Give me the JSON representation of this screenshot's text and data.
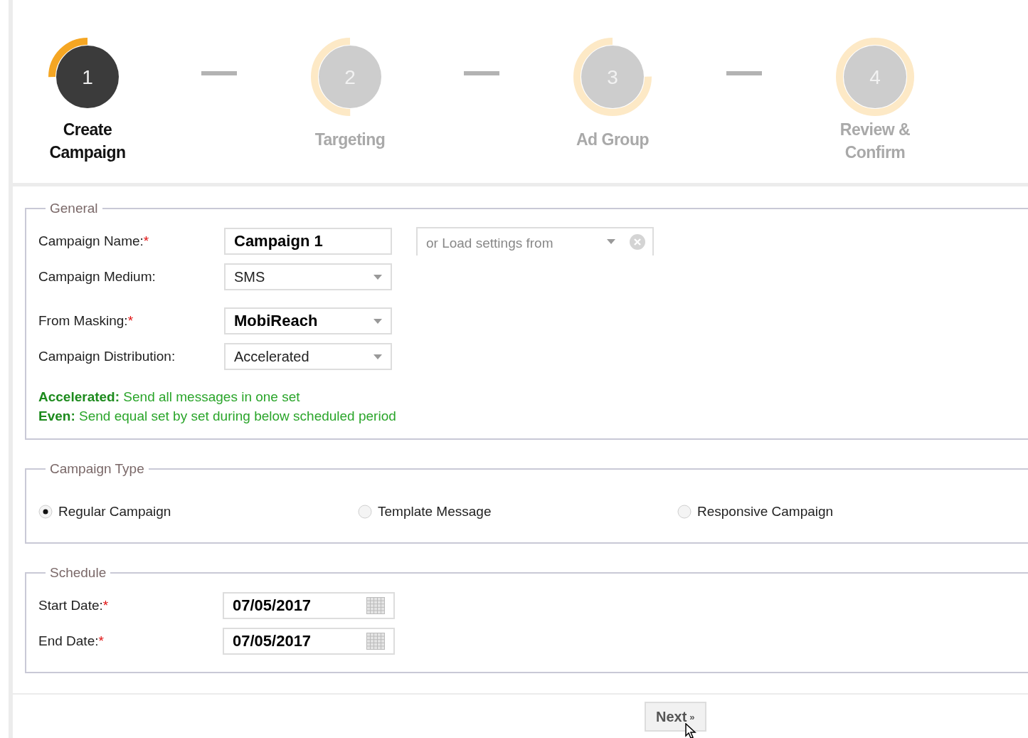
{
  "steps": [
    {
      "number": "1",
      "label": "Create Campaign",
      "selected": true
    },
    {
      "number": "2",
      "label": "Targeting",
      "selected": false
    },
    {
      "number": "3",
      "label": "Ad Group",
      "selected": false
    },
    {
      "number": "4",
      "label": "Review & Confirm",
      "selected": false
    }
  ],
  "general": {
    "legend": "General",
    "fields": [
      {
        "kind": "text",
        "label": "Campaign Name:",
        "required_mark": "*",
        "value": "Campaign 1",
        "bold": true
      },
      {
        "kind": "select",
        "label": "Campaign Medium:",
        "value": "SMS",
        "bold": false
      },
      {
        "kind": "select",
        "label": "From Masking:",
        "required_mark": "*",
        "value": "MobiReach",
        "bold": true
      },
      {
        "kind": "select",
        "label": "Campaign Distribution:",
        "value": "Accelerated",
        "bold": false
      }
    ],
    "load_settings": {
      "placeholder": "or Load settings from"
    },
    "notes": [
      "**Accelerated:** Send all messages in one set",
      "**Even:** Send equal set by set during below scheduled period"
    ]
  },
  "campaign_type": {
    "legend": "Campaign Type",
    "options": [
      {
        "label": "Regular Campaign",
        "selected": true
      },
      {
        "label": "Template Message",
        "selected": false
      },
      {
        "label": "Responsive Campaign",
        "selected": false
      }
    ]
  },
  "schedule": {
    "legend": "Schedule",
    "fields": [
      {
        "label": "Start Date:",
        "required_mark": "*",
        "value": "07/05/2017"
      },
      {
        "label": "End Date:",
        "required_mark": "*",
        "value": "07/05/2017"
      }
    ]
  },
  "next_button": {
    "label": "Next",
    "icon": "»"
  }
}
